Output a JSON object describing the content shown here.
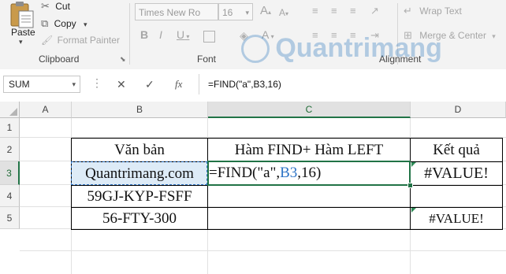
{
  "ribbon": {
    "clipboard": {
      "paste_label": "Paste",
      "cut_label": "Cut",
      "copy_label": "Copy",
      "format_painter_label": "Format Painter",
      "group_label": "Clipboard"
    },
    "font": {
      "font_name": "Times New Ro",
      "font_size": "16",
      "bold": "B",
      "italic": "I",
      "underline": "U",
      "grow": "A",
      "shrink": "A",
      "color": "A",
      "group_label": "Font"
    },
    "alignment": {
      "wrap_text_label": "Wrap Text",
      "merge_center_label": "Merge & Center",
      "group_label": "Alignment"
    }
  },
  "formula_bar": {
    "name_box": "SUM",
    "cancel": "✕",
    "enter": "✓",
    "fx": "fx",
    "formula": "=FIND(\"a\",B3,16)"
  },
  "columns": [
    "A",
    "B",
    "C",
    "D"
  ],
  "rows": [
    "1",
    "2",
    "3",
    "4",
    "5"
  ],
  "table": {
    "headers": [
      "Văn bản",
      "Hàm FIND+ Hàm LEFT",
      "Kết quả"
    ],
    "rows": [
      {
        "b": "Quantrimang.com",
        "d": "#VALUE!"
      },
      {
        "b": "59GJ-KYP-FSFF",
        "d": ""
      },
      {
        "b": "56-FTY-300",
        "d": "#VALUE!"
      }
    ],
    "edit_prefix": "=FIND(\"a\",",
    "edit_ref": "B3",
    "edit_suffix": ",16)"
  },
  "watermark": "Quantrimang",
  "colors": {
    "excel_green": "#217346",
    "ref_blue": "#2e74c6"
  }
}
